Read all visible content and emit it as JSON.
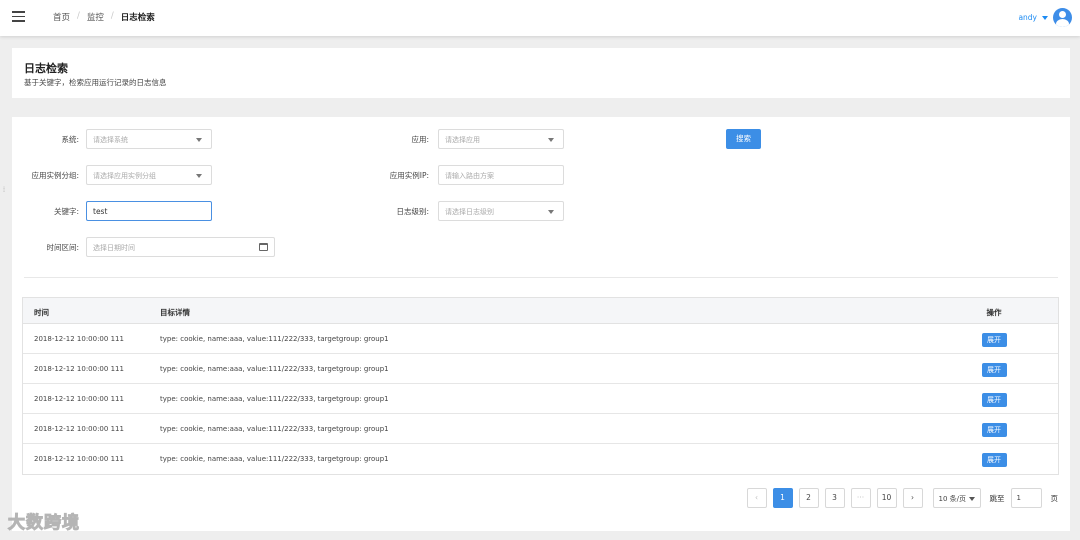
{
  "breadcrumb": {
    "home": "首页",
    "monitor": "监控",
    "current": "日志检索"
  },
  "user": {
    "name": "andy"
  },
  "header": {
    "title": "日志检索",
    "subtitle": "基于关键字，检索应用运行记录的日志信息"
  },
  "filters": {
    "system": {
      "label": "系统:",
      "placeholder": "请选择系统"
    },
    "app": {
      "label": "应用:",
      "placeholder": "请选择应用"
    },
    "instance_group": {
      "label": "应用实例分组:",
      "placeholder": "请选择应用实例分组"
    },
    "instance_ip": {
      "label": "应用实例IP:",
      "placeholder": "请输入路由方案"
    },
    "keyword": {
      "label": "关键字:",
      "value": "test"
    },
    "log_level": {
      "label": "日志级别:",
      "placeholder": "请选择日志级别"
    },
    "time_range": {
      "label": "时间区间:",
      "placeholder": "选择日期时间"
    },
    "search_label": "搜索"
  },
  "table": {
    "headers": {
      "time": "时间",
      "detail": "目标详情",
      "op": "操作"
    },
    "expand_label": "展开",
    "rows": [
      {
        "time": "2018-12-12 10:00:00 111",
        "detail": "type: cookie, name:aaa, value:111/222/333, targetgroup: group1"
      },
      {
        "time": "2018-12-12 10:00:00 111",
        "detail": "type: cookie, name:aaa, value:111/222/333, targetgroup: group1"
      },
      {
        "time": "2018-12-12 10:00:00 111",
        "detail": "type: cookie, name:aaa, value:111/222/333, targetgroup: group1"
      },
      {
        "time": "2018-12-12 10:00:00 111",
        "detail": "type: cookie, name:aaa, value:111/222/333, targetgroup: group1"
      },
      {
        "time": "2018-12-12 10:00:00 111",
        "detail": "type: cookie, name:aaa, value:111/222/333, targetgroup: group1"
      }
    ]
  },
  "pagination": {
    "prev": "‹",
    "next": "›",
    "pages": [
      "1",
      "2",
      "3"
    ],
    "ellipsis": "···",
    "last": "10",
    "current": "1",
    "page_size": "10 条/页",
    "jump_label": "跳至",
    "jump_value": "1",
    "page_unit": "页"
  },
  "watermark": "大数跨境",
  "colors": {
    "primary": "#3c8ee6",
    "background": "#eeeeee"
  }
}
